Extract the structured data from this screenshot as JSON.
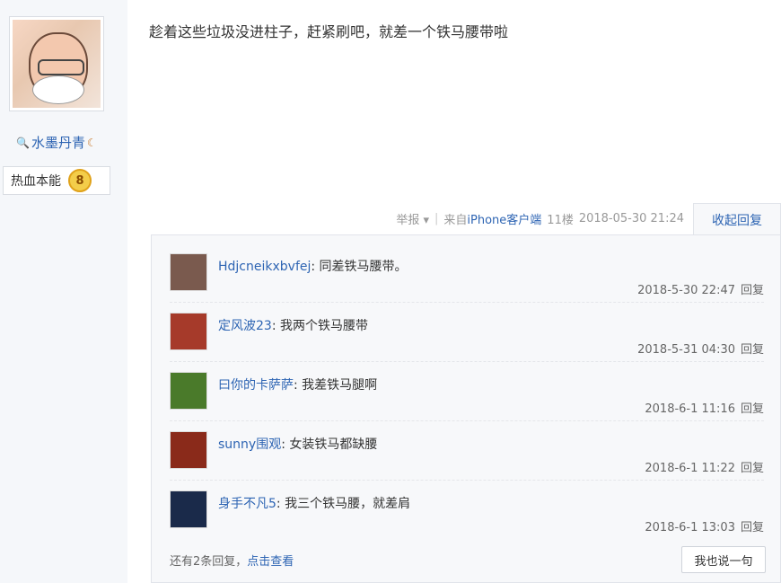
{
  "user": {
    "name": "水墨丹青",
    "level_title": "热血本能",
    "level": "8"
  },
  "post": {
    "text": "趁着这些垃圾没进柱子，赶紧刷吧，就差一个铁马腰带啦"
  },
  "meta": {
    "report": "举报",
    "separator": "|",
    "source_prefix": "来自",
    "source": "iPhone客户端",
    "floor": "11楼",
    "datetime": "2018-05-30 21:24",
    "collapse_label": "收起回复"
  },
  "replies": [
    {
      "author": "Hdjcneikxbvfej",
      "content": ": 同差铁马腰带。",
      "time": "2018-5-30 22:47",
      "reply_label": "回复",
      "avatar_color": "#7a5a4e"
    },
    {
      "author": "定风波23",
      "content": ": 我两个铁马腰带",
      "time": "2018-5-31 04:30",
      "reply_label": "回复",
      "avatar_color": "#a63a2a"
    },
    {
      "author": "曰你的卡萨萨",
      "content": ": 我差铁马腿啊",
      "time": "2018-6-1 11:16",
      "reply_label": "回复",
      "avatar_color": "#4a7a2a"
    },
    {
      "author": "sunny围观",
      "content": ": 女装铁马都缺腰",
      "time": "2018-6-1 11:22",
      "reply_label": "回复",
      "avatar_color": "#8a2a1a"
    },
    {
      "author": "身手不凡5",
      "content": ": 我三个铁马腰，就差肩",
      "time": "2018-6-1 13:03",
      "reply_label": "回复",
      "avatar_color": "#1a2a4a"
    }
  ],
  "footer": {
    "more_prefix": "还有2条回复，",
    "more_link": "点击查看",
    "say_button": "我也说一句"
  }
}
